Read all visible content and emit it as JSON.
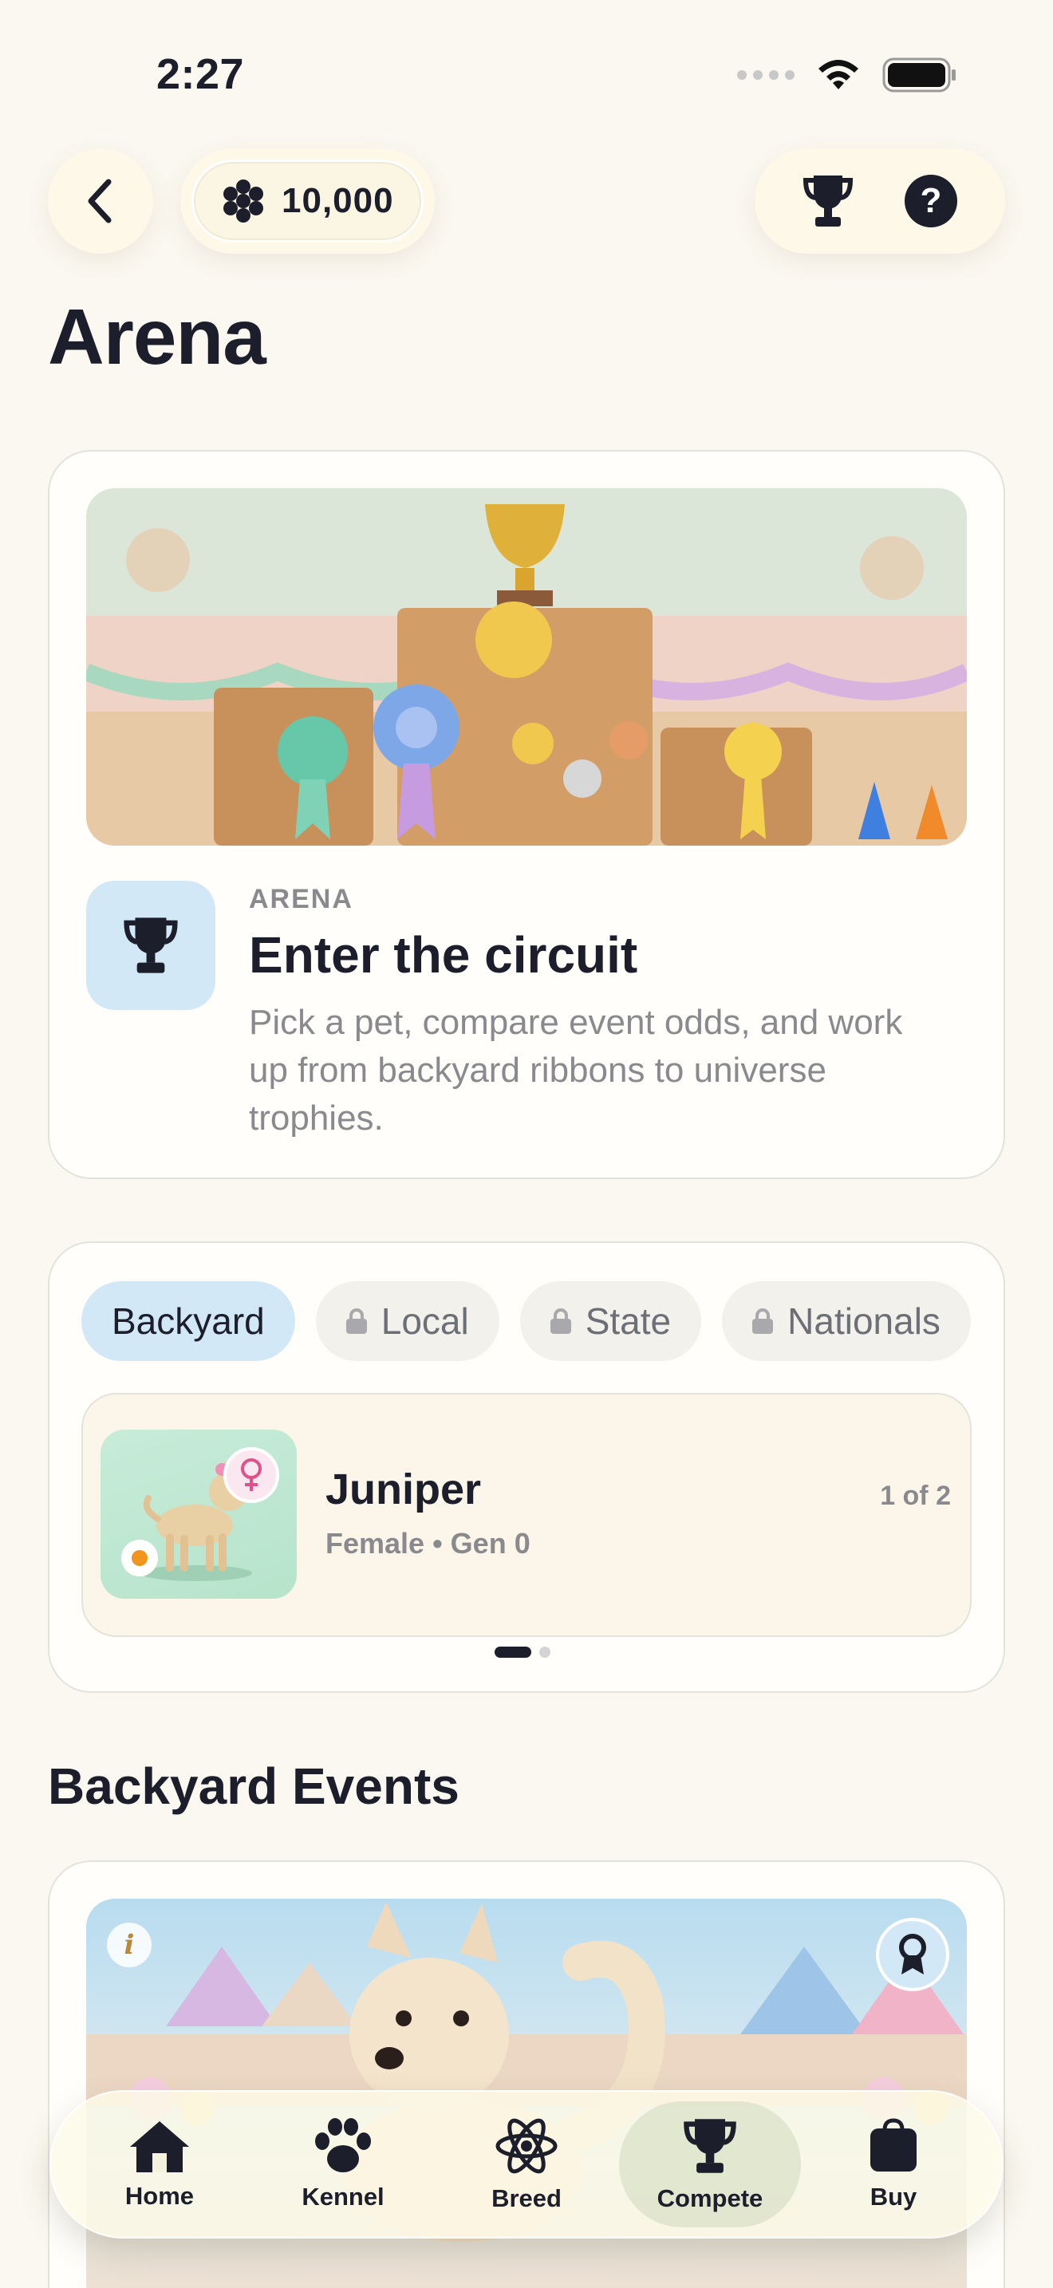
{
  "status_bar": {
    "time": "2:27"
  },
  "header": {
    "coins": "10,000"
  },
  "page": {
    "title": "Arena"
  },
  "intro": {
    "eyebrow": "ARENA",
    "title": "Enter the circuit",
    "description": "Pick a pet, compare event odds, and work up from backyard ribbons to universe trophies."
  },
  "tiers": {
    "tabs": [
      {
        "label": "Backyard",
        "locked": false,
        "selected": true
      },
      {
        "label": "Local",
        "locked": true
      },
      {
        "label": "State",
        "locked": true
      },
      {
        "label": "Nationals",
        "locked": true
      }
    ]
  },
  "pet": {
    "name": "Juniper",
    "meta": "Female • Gen 0",
    "count": "1 of 2",
    "gender_icon": "female-symbol-icon"
  },
  "events": {
    "section_title": "Backyard Events"
  },
  "nav": {
    "items": [
      {
        "label": "Home",
        "icon": "home-icon"
      },
      {
        "label": "Kennel",
        "icon": "paw-icon"
      },
      {
        "label": "Breed",
        "icon": "atom-icon"
      },
      {
        "label": "Compete",
        "icon": "trophy-icon",
        "active": true
      },
      {
        "label": "Buy",
        "icon": "shopping-bag-icon"
      }
    ]
  },
  "colors": {
    "background": "#fbf8f1",
    "accent_blue": "#d3e8f6",
    "text_dark": "#1c1e2b",
    "text_muted": "#8a8a8e",
    "status_orange": "#f0961f"
  }
}
